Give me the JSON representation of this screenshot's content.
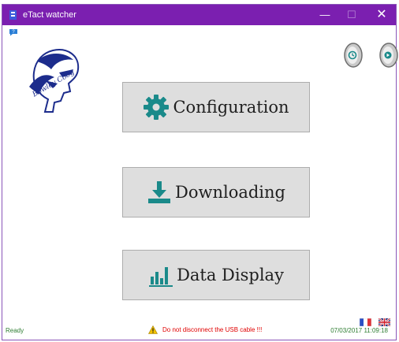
{
  "window": {
    "title": "eTact watcher"
  },
  "controls": {
    "minimize": "—",
    "maximize": "☐",
    "close": "✕"
  },
  "logo": {
    "caption": "Bowley Coog"
  },
  "buttons": {
    "configuration": "Configuration",
    "downloading": "Downloading",
    "data_display": "Data Display"
  },
  "icons": {
    "help": "help-icon",
    "clock": "clock-icon",
    "next": "next-icon",
    "configuration": "gear-icon",
    "downloading": "download-icon",
    "data_display": "bar-chart-icon"
  },
  "languages": [
    "fr",
    "en"
  ],
  "status": {
    "left": "Ready",
    "warning": "Do not disconnect the USB cable !!!",
    "datetime": "07/03/2017 11:09:18"
  },
  "colors": {
    "title_bar": "#7b1fb0",
    "accent": "#1a8a8a",
    "warning": "#e00000",
    "status_text": "#2e7d32"
  }
}
